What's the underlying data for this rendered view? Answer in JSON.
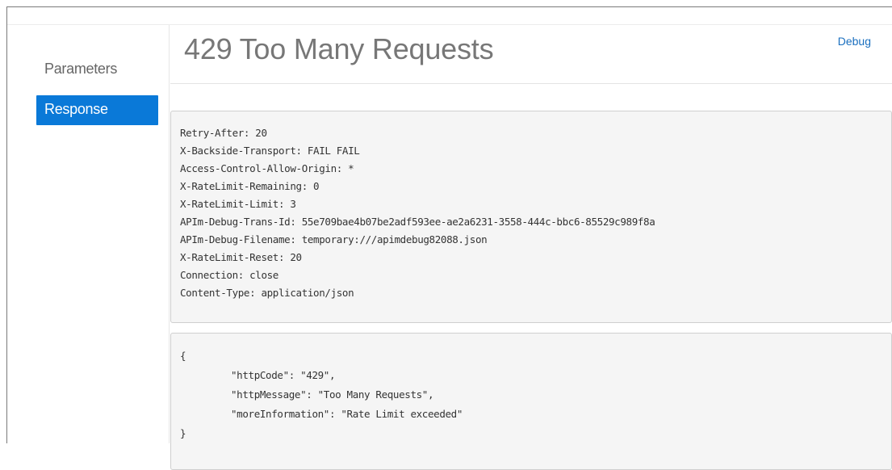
{
  "nav": {
    "parameters_label": "Parameters",
    "response_label": "Response"
  },
  "main": {
    "title": "429 Too Many Requests",
    "debug_label": "Debug"
  },
  "response_headers": [
    "Retry-After: 20",
    "X-Backside-Transport: FAIL FAIL",
    "Access-Control-Allow-Origin: *",
    "X-RateLimit-Remaining: 0",
    "X-RateLimit-Limit: 3",
    "APIm-Debug-Trans-Id: 55e709bae4b07be2adf593ee-ae2a6231-3558-444c-bbc6-85529c989f8a",
    "APIm-Debug-Filename: temporary:///apimdebug82088.json",
    "X-RateLimit-Reset: 20",
    "Connection: close",
    "Content-Type: application/json"
  ],
  "response_body": {
    "open_brace": "{",
    "lines": [
      "\"httpCode\": \"429\",",
      "\"httpMessage\": \"Too Many Requests\",",
      "\"moreInformation\": \"Rate Limit exceeded\""
    ],
    "close_brace": "}"
  },
  "colors": {
    "accent": "#0a79d8",
    "link": "#1a6fbf",
    "title": "#777777",
    "code_bg": "#f5f5f5"
  }
}
